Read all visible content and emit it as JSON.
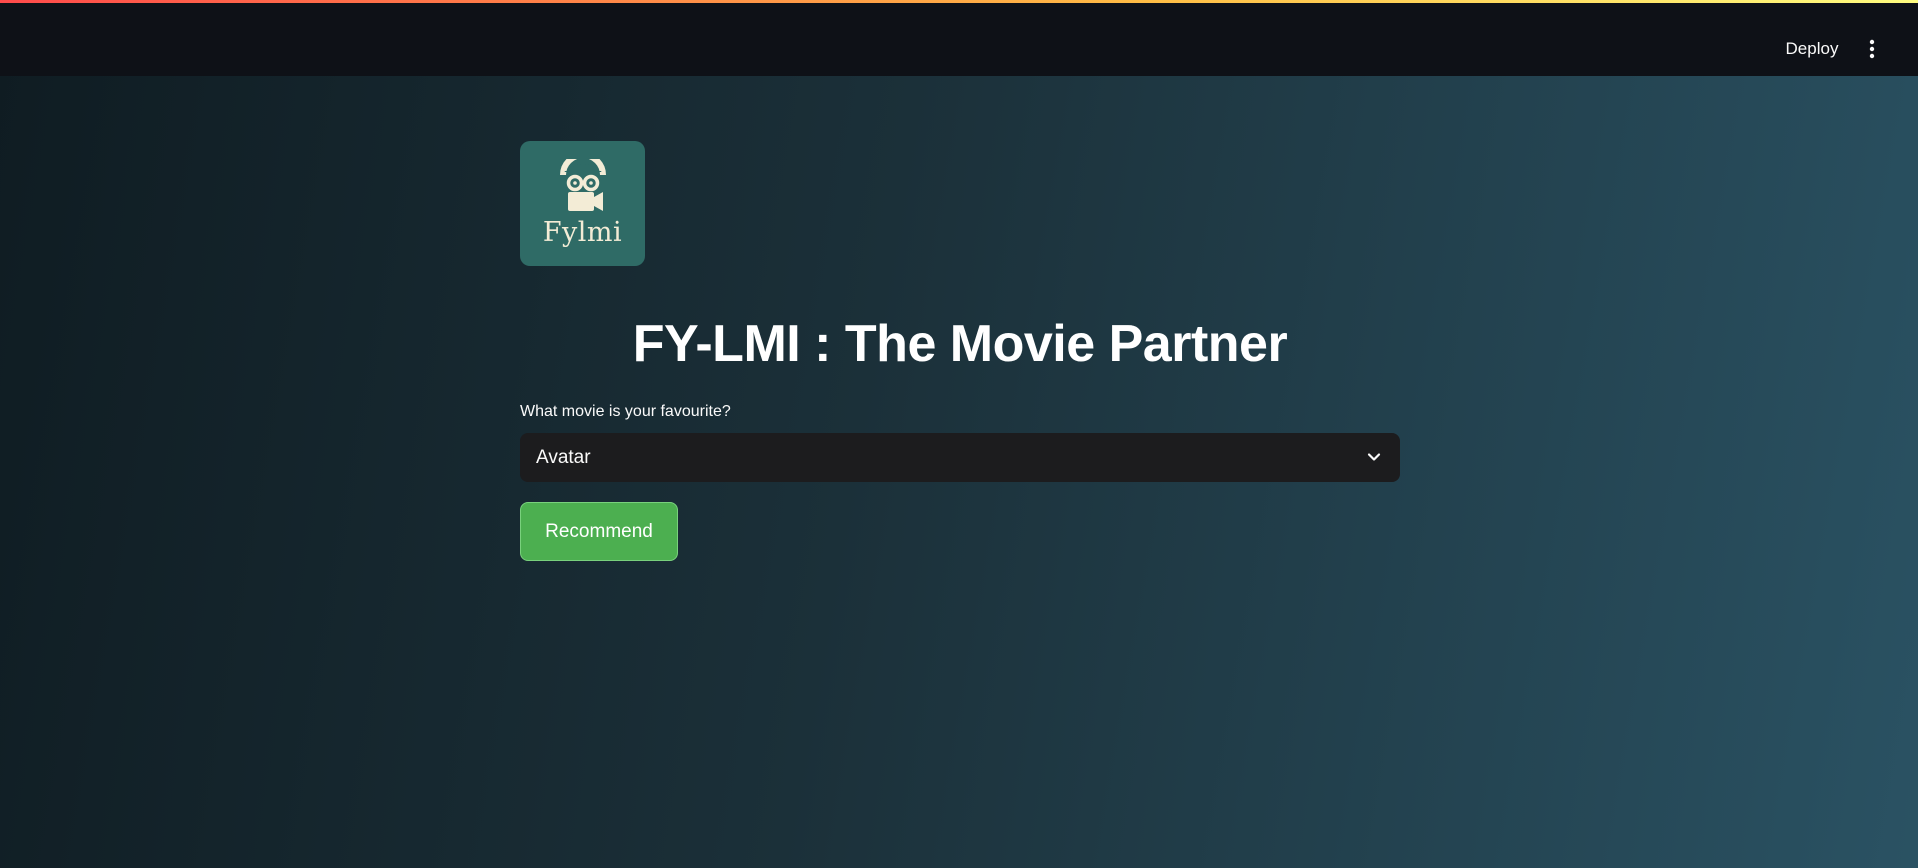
{
  "header": {
    "deploy_label": "Deploy",
    "menu_icon": "vertical-ellipsis-icon"
  },
  "logo": {
    "icon": "film-reel-camera-icon",
    "text": "Fylmi",
    "background": "#2f6b66"
  },
  "main": {
    "title": "FY-LMI : The Movie Partner",
    "select": {
      "label": "What movie is your favourite?",
      "value": "Avatar",
      "icon": "chevron-down-icon"
    },
    "recommend_label": "Recommend",
    "recommend_color": "#4caf50"
  }
}
